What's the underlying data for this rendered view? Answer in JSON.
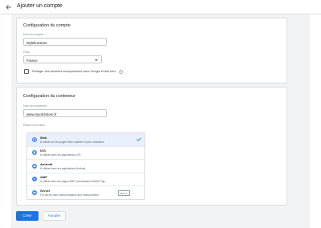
{
  "header": {
    "title": "Ajouter un compte"
  },
  "account": {
    "section_title": "Configuration du compte",
    "name_label": "Nom du compte",
    "name_value": "Mylelinestore",
    "country_label": "Pays",
    "country_value": "France",
    "share_label": "Partager des données anonymement avec Google et des tiers",
    "share_checked": false
  },
  "container": {
    "section_title": "Configuration du conteneur",
    "name_label": "Nom du conteneur",
    "name_value": "www.myotrestore.fr",
    "platform_label": "Plate-forme cible",
    "platforms": [
      {
        "name": "Web",
        "desc": "À utiliser sur les pages Web mobiles et pour ordinateur",
        "selected": true
      },
      {
        "name": "iOS",
        "desc": "À utiliser dans les applications iOS"
      },
      {
        "name": "Android",
        "desc": "À utiliser dans les applications Android"
      },
      {
        "name": "AMP",
        "desc": "À utiliser dans les pages AMP (Accelerated Mobile Pag..."
      },
      {
        "name": "Server",
        "desc": "For server-side instrumentation and measurement",
        "badge": "BETA"
      }
    ]
  },
  "actions": {
    "create": "Créer",
    "cancel": "Annuler"
  },
  "colors": {
    "accent": "#1a73e8",
    "selected_bg": "#e8f0fe",
    "canvas": "#f1f3f4"
  }
}
